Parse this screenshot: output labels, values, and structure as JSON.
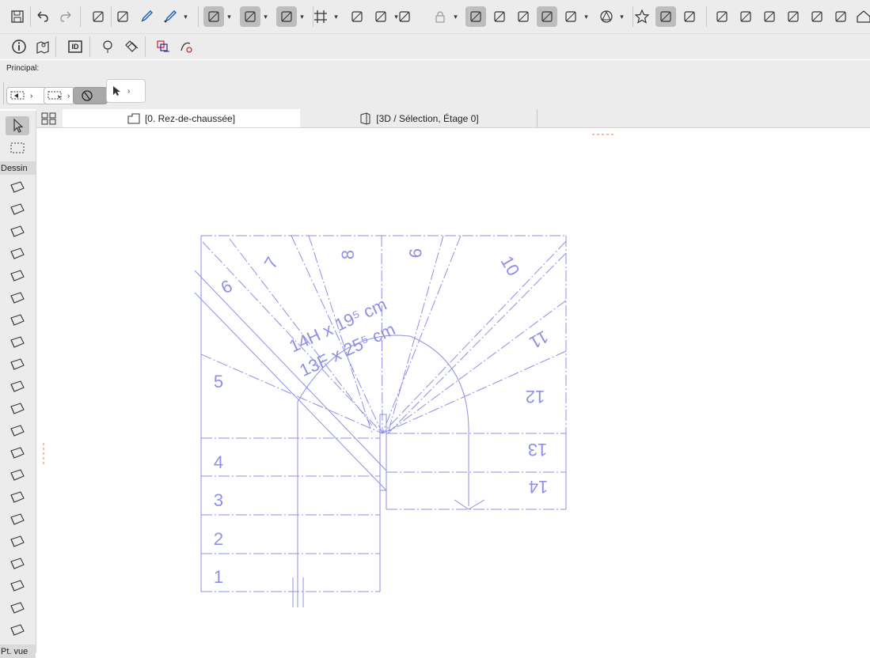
{
  "colors": {
    "drawing": "#8f8fe6",
    "accent": "#e08050"
  },
  "toolbar1": {
    "icons": [
      "save-icon",
      "undo-icon",
      "redo-icon",
      "layout-magic-icon",
      "pick-up-icon",
      "eyedropper-icon",
      "inject-icon",
      "guideline-icon",
      "snap-guide-icon",
      "relative-construction-icon",
      "grid-snap-icon",
      "plane-icon",
      "surface-icon",
      "trace-icon",
      "lock-icon",
      "suspend-groups-icon",
      "measure-icon",
      "fit-icon",
      "marquee-icon",
      "render-icon",
      "shape-icon",
      "favorites-icon",
      "view-toggle-icon",
      "layers-stack-icon",
      "split-icon",
      "adjust-icon",
      "elevate-icon",
      "fillet-icon",
      "curve-icon",
      "resize-icon",
      "house-icon"
    ]
  },
  "toolbar2": {
    "icons": [
      "info-icon",
      "map-pin-icon",
      "id-icon",
      "tree-icon",
      "tags-icon",
      "layer-combo-icon",
      "renovation-icon"
    ],
    "id_text": "ID"
  },
  "infobox": {
    "label": "Principal:"
  },
  "tabs": [
    {
      "label": "[0. Rez-de-chaussée]",
      "icon": "floor-plan-icon"
    },
    {
      "label": "[3D / Sélection, Étage 0]",
      "icon": "3d-view-icon"
    }
  ],
  "sidebar": {
    "headers": [
      "Dessin",
      "Pt. vue"
    ],
    "tools": [
      "arrow-tool",
      "marquee-tool",
      "wall-tool",
      "column-tool",
      "beam-tool",
      "slab-tool",
      "roof-tool",
      "shell-tool",
      "stair-tool",
      "railing-tool",
      "curtain-wall-tool",
      "door-tool",
      "window-tool",
      "skylight-tool",
      "opening-tool",
      "object-tool",
      "mesh-tool",
      "morph-tool",
      "zone-tool",
      "lamp-tool",
      "3d-object-tool",
      "curtain-tool",
      "section-tool"
    ]
  },
  "drawing": {
    "step_numbers": [
      "1",
      "2",
      "3",
      "4",
      "5",
      "6",
      "7",
      "8",
      "9",
      "10",
      "11",
      "12",
      "13",
      "14"
    ],
    "dimension_line1": "14H x 19⁵ cm",
    "dimension_line2": "13F x 25⁵ cm"
  }
}
